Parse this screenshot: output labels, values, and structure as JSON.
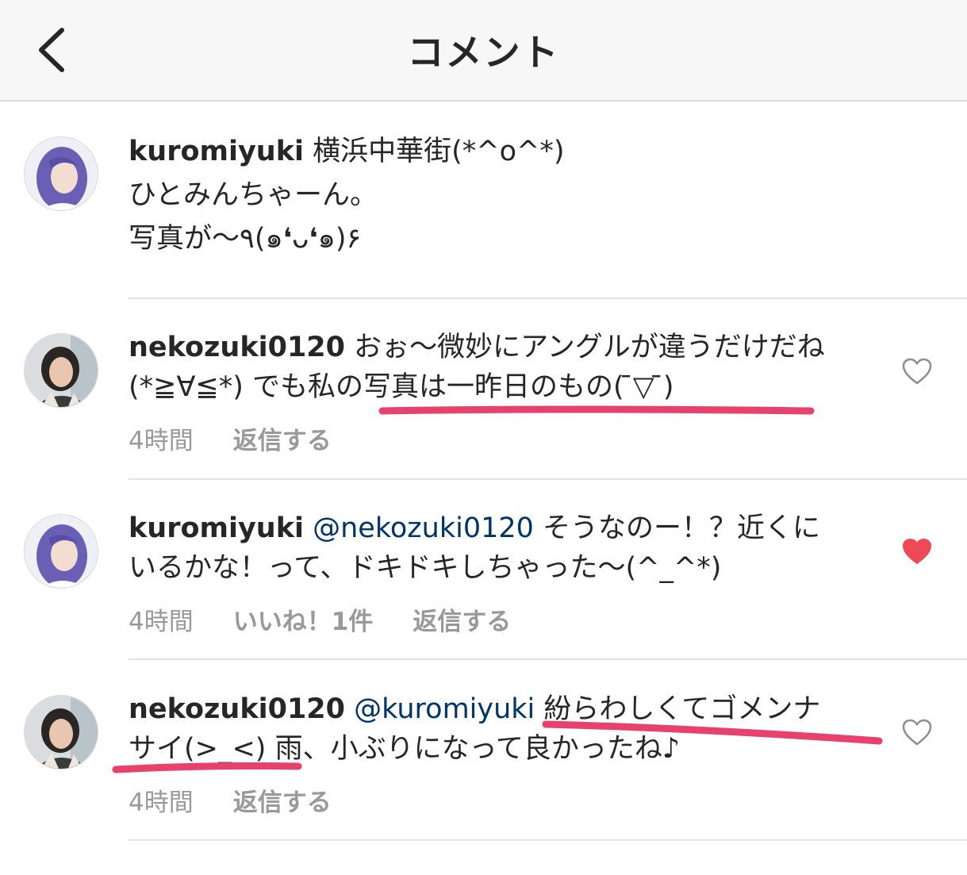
{
  "header": {
    "title": "コメント"
  },
  "comments": [
    {
      "username": "kuromiyuki",
      "text": " 横浜中華街(*^o^*)\nひとみんちゃーん。\n写真が〜٩(๑❛ᴗ❛๑)۶",
      "avatar": "purple-hair-avatar"
    },
    {
      "username": "nekozuki0120",
      "text": " おぉ〜微妙にアングルが違うだけだね(*≧∀≦*) でも私の写真は一昨日のもの( ̄▽ ̄)",
      "time": "4時間",
      "reply": "返信する",
      "liked": false,
      "avatar": "dark-hair-avatar"
    },
    {
      "username": "kuromiyuki",
      "mention": "@nekozuki0120",
      "text": " そうなのー！？近くにいるかな！って、ドキドキしちゃった〜(^_^*)",
      "time": "4時間",
      "likes": "いいね！1件",
      "reply": "返信する",
      "liked": true,
      "avatar": "purple-hair-avatar"
    },
    {
      "username": "nekozuki0120",
      "mention": "@kuromiyuki",
      "text": " 紛らわしくてゴメンナサイ(>_<) 雨、小ぶりになって良かったね♪",
      "time": "4時間",
      "reply": "返信する",
      "liked": false,
      "avatar": "dark-hair-avatar"
    }
  ],
  "colors": {
    "heart_liked": "#ed4956",
    "underline_mark": "#e8426c",
    "mention": "#003569",
    "meta": "#999999"
  }
}
